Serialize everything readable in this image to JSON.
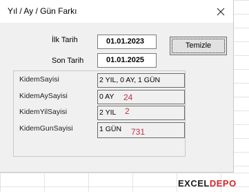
{
  "window": {
    "title": "Yıl / Ay / Gün Farkı",
    "close_glyph": "✕"
  },
  "form": {
    "start_label": "İlk Tarih",
    "start_value": "01.01.2023",
    "end_label": "Son Tarih",
    "end_value": "01.01.2025",
    "clear_button": "Temizle"
  },
  "results": [
    {
      "label": "KidemSayisi",
      "value": "2 YIL, 0 AY, 1 GÜN",
      "note": ""
    },
    {
      "label": "KidemAySayisi",
      "value": "0 AY",
      "note": "24"
    },
    {
      "label": "KidemYilSayisi",
      "value": "2 YIL",
      "note": "2"
    },
    {
      "label": "KidemGunSayisi",
      "value": "1 GÜN",
      "note": "731"
    }
  ],
  "watermark": {
    "part1": "EXCEL",
    "part2": "DEPO"
  },
  "colors": {
    "note": "#c0304a",
    "dialog_bg": "#f0f0f0",
    "brand_red": "#d4242a"
  }
}
